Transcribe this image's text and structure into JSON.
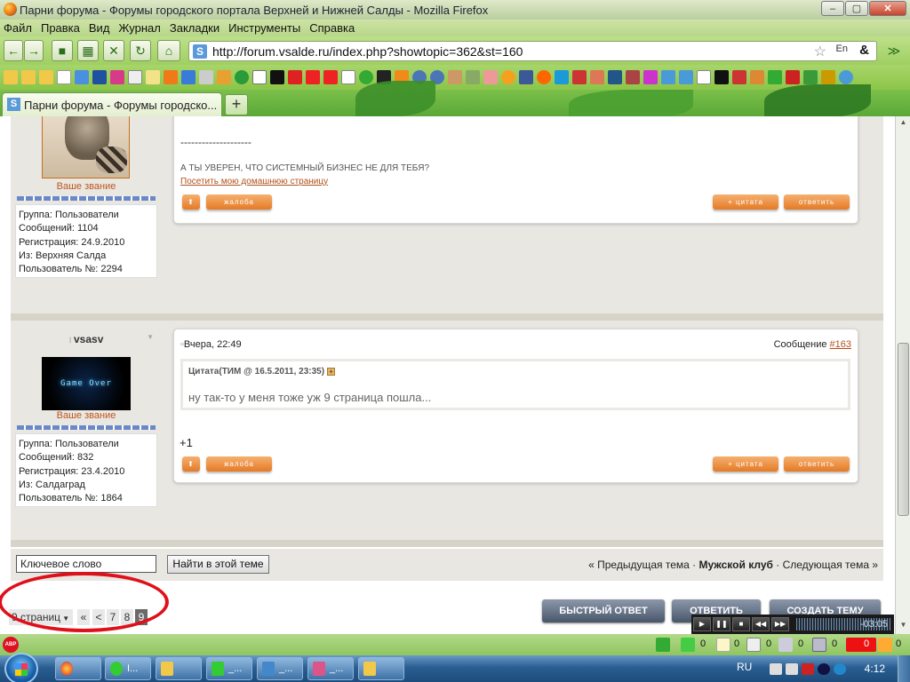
{
  "window": {
    "title": "Парни форума - Форумы городского портала Верхней и Нижней Салды - Mozilla Firefox",
    "min": "–",
    "max": "▢",
    "close": "✕"
  },
  "menu": [
    "Файл",
    "Правка",
    "Вид",
    "Журнал",
    "Закладки",
    "Инструменты",
    "Справка"
  ],
  "nav": {
    "back_icon": "←",
    "forward_icon": "→",
    "url": "http://forum.vsalde.ru/index.php?showtopic=362&st=160",
    "favicon": "S",
    "lang": "En"
  },
  "tabs": {
    "active_label": "Парни форума - Форумы городско...",
    "new_tab": "+"
  },
  "post1": {
    "rank": "Ваше звание",
    "group": "Группа: Пользователи",
    "messages": "Сообщений: 1104",
    "registered": "Регистрация: 24.9.2010",
    "from": "Из: Верхняя Салда",
    "user_no": "Пользователь №: 2294",
    "sig_dashes": "--------------------",
    "sig_text": "А ТЫ УВЕРЕН, ЧТО СИСТЕМНЫЙ БИЗНЕС НЕ ДЛЯ ТЕБЯ?",
    "homepage_link": "Посетить мою домашнюю страницу",
    "complaint": "жалоба",
    "quote": "+ цитата",
    "reply": "ответить"
  },
  "post2": {
    "username": "vsasv",
    "avatar_text": "Game Over",
    "rank": "Ваше звание",
    "date": "Вчера, 22:49",
    "msg_label": "Сообщение ",
    "msg_link": "#163",
    "quote_head": "Цитата(ТИМ @ 16.5.2011, 23:35)",
    "quote_plus": "+",
    "quote_text": "ну так-то у меня тоже уж 9 страница пошла...",
    "body": "+1",
    "group": "Группа: Пользователи",
    "messages": "Сообщений: 832",
    "registered": "Регистрация: 23.4.2010",
    "from": "Из: Салдаград",
    "user_no": "Пользователь №: 1864",
    "complaint": "жалоба",
    "quote": "+ цитата",
    "reply": "ответить"
  },
  "search": {
    "keyword": "Ключевое слово",
    "find_button": "Найти в этой теме",
    "prev": "« Предыдущая тема · ",
    "forum": "Мужской клуб",
    "next": " · Следующая тема »"
  },
  "pager": {
    "pages_label": "9 страниц",
    "first": "«",
    "prev": "<",
    "p7": "7",
    "p8": "8",
    "p9": "9"
  },
  "actions": {
    "quick_reply": "БЫСТРЫЙ ОТВЕТ",
    "reply": "ОТВЕТИТЬ",
    "new_topic": "СОЗДАТЬ ТЕМУ"
  },
  "player": {
    "time": "-03:05"
  },
  "statusbar": {
    "abp": "ABP",
    "counts": [
      "0",
      "0",
      "0",
      "0",
      "0",
      "0",
      "0"
    ]
  },
  "taskbar": {
    "btn1": "I...",
    "btn2": "_...",
    "btn3": "_...",
    "btn4": "_...",
    "lang": "RU",
    "clock": "4:12"
  }
}
